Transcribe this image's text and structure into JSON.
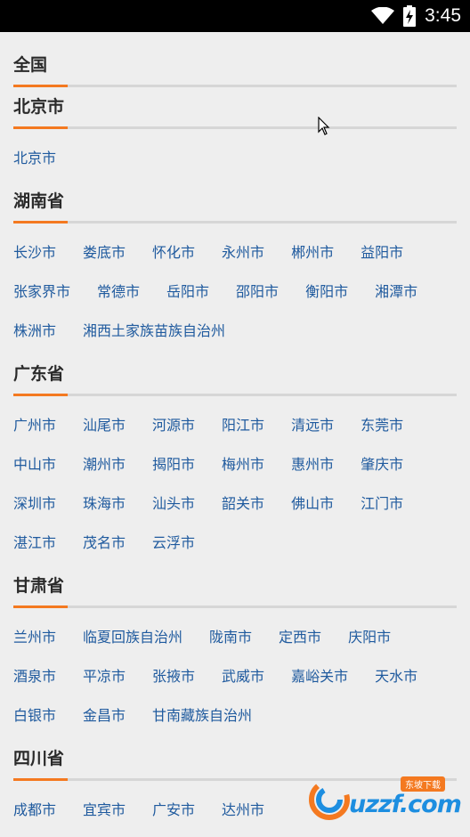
{
  "status_bar": {
    "time": "3:45"
  },
  "sections": [
    {
      "title": "全国",
      "cities": []
    },
    {
      "title": "北京市",
      "cities": [
        "北京市"
      ]
    },
    {
      "title": "湖南省",
      "cities": [
        "长沙市",
        "娄底市",
        "怀化市",
        "永州市",
        "郴州市",
        "益阳市",
        "张家界市",
        "常德市",
        "岳阳市",
        "邵阳市",
        "衡阳市",
        "湘潭市",
        "株洲市",
        "湘西土家族苗族自治州"
      ]
    },
    {
      "title": "广东省",
      "cities": [
        "广州市",
        "汕尾市",
        "河源市",
        "阳江市",
        "清远市",
        "东莞市",
        "中山市",
        "潮州市",
        "揭阳市",
        "梅州市",
        "惠州市",
        "肇庆市",
        "深圳市",
        "珠海市",
        "汕头市",
        "韶关市",
        "佛山市",
        "江门市",
        "湛江市",
        "茂名市",
        "云浮市"
      ]
    },
    {
      "title": "甘肃省",
      "cities": [
        "兰州市",
        "临夏回族自治州",
        "陇南市",
        "定西市",
        "庆阳市",
        "酒泉市",
        "平凉市",
        "张掖市",
        "武威市",
        "嘉峪关市",
        "天水市",
        "白银市",
        "金昌市",
        "甘南藏族自治州"
      ]
    },
    {
      "title": "四川省",
      "cities": [
        "成都市",
        "宜宾市",
        "广安市",
        "达州市"
      ]
    }
  ],
  "watermark": {
    "text": "uzzf.com",
    "tag": "东坡下载"
  },
  "colors": {
    "accent": "#f47920",
    "link": "#1f5a9e",
    "background": "#eeeeee"
  }
}
